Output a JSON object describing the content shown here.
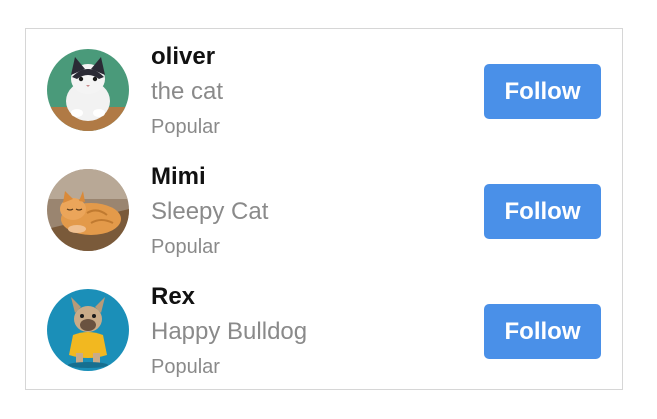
{
  "follow_list": {
    "items": [
      {
        "name": "oliver",
        "description": "the cat",
        "tag": "Popular",
        "follow_label": "Follow",
        "avatar_icon": "black-white-cat-photo",
        "avatar_bg": "#4a9a7a"
      },
      {
        "name": "Mimi",
        "description": "Sleepy Cat",
        "tag": "Popular",
        "follow_label": "Follow",
        "avatar_icon": "orange-tabby-cat-photo",
        "avatar_bg": "#9a8570"
      },
      {
        "name": "Rex",
        "description": "Happy Bulldog",
        "tag": "Popular",
        "follow_label": "Follow",
        "avatar_icon": "french-bulldog-photo",
        "avatar_bg": "#1b8fb8"
      }
    ],
    "accent_color": "#4a90e8"
  }
}
